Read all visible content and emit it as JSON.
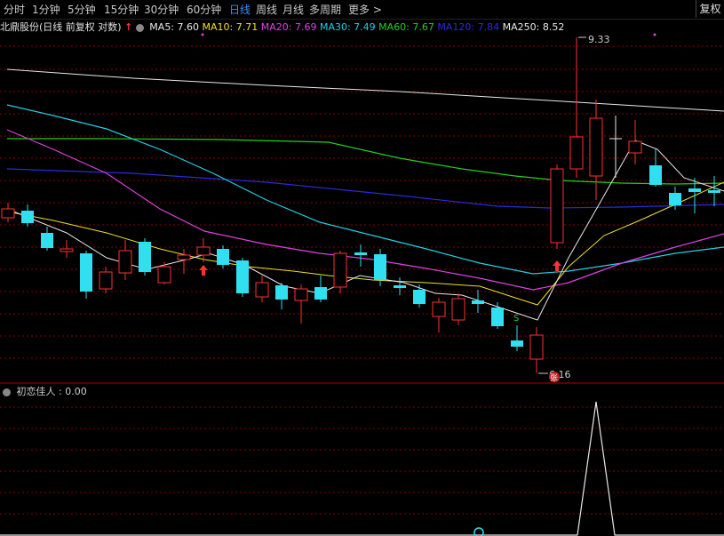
{
  "tabs": [
    {
      "label": "分时",
      "active": false
    },
    {
      "label": "1分钟",
      "active": false
    },
    {
      "label": "5分钟",
      "active": false
    },
    {
      "label": "15分钟",
      "active": false
    },
    {
      "label": "30分钟",
      "active": false
    },
    {
      "label": "60分钟",
      "active": false
    },
    {
      "label": "日线",
      "active": true
    },
    {
      "label": "周线",
      "active": false
    },
    {
      "label": "月线",
      "active": false
    },
    {
      "label": "多周期",
      "active": false
    },
    {
      "label": "更多 >",
      "active": false
    }
  ],
  "fuquan_label": "复权",
  "stock": {
    "title": "北鼎股份(日线 前复权 对数)",
    "up_arrow_color": "#ff3030"
  },
  "ma_legend": [
    {
      "label": "MA5: 7.60",
      "color": "#e8e8e8"
    },
    {
      "label": "MA10: 7.71",
      "color": "#f0e020"
    },
    {
      "label": "MA20: 7.69",
      "color": "#e040e0"
    },
    {
      "label": "MA30: 7.49",
      "color": "#20d0e0"
    },
    {
      "label": "MA60: 7.67",
      "color": "#20d020"
    },
    {
      "label": "MA120: 7.84",
      "color": "#2a2ae0"
    },
    {
      "label": "MA250: 8.52",
      "color": "#e8e8e8"
    }
  ],
  "price_annotations": {
    "high": "9.33",
    "low": "6.16"
  },
  "indicator": {
    "title": "初恋佳人 : 0.00"
  },
  "colors": {
    "up": "#ff3030",
    "down": "#30e0f0",
    "grid": "#8b0000"
  }
}
